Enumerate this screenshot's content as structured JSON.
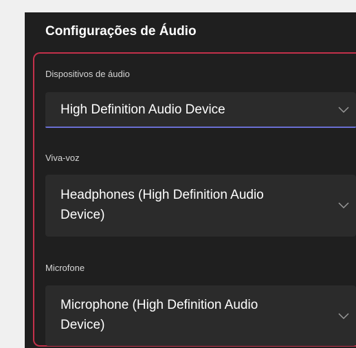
{
  "panel": {
    "title": "Configurações de Áudio"
  },
  "fields": {
    "audio_devices": {
      "label": "Dispositivos de áudio",
      "value": "High Definition Audio Device"
    },
    "speaker": {
      "label": "Viva-voz",
      "value": "Headphones (High Definition Audio Device)"
    },
    "microphone": {
      "label": "Microfone",
      "value": "Microphone (High Definition Audio Device)"
    }
  },
  "icons": {
    "dropdown": "chevron-down-icon"
  },
  "colors": {
    "panel_background": "#1f1f1f",
    "select_background": "#2b2b2b",
    "focus_underline": "#6a6fd4",
    "highlight_border": "#c4314b"
  }
}
